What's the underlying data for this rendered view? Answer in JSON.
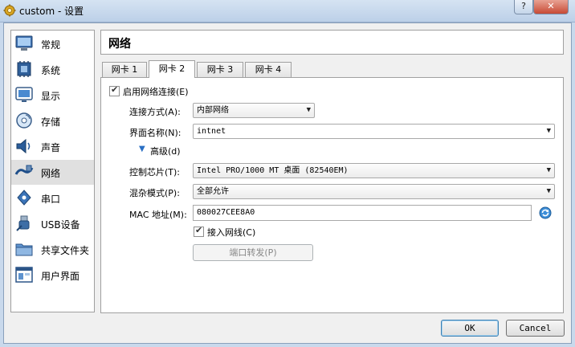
{
  "window": {
    "title": "custom - 设置",
    "help_label": "?",
    "close_label": "✕"
  },
  "sidebar": {
    "items": [
      {
        "label": "常规",
        "icon": "general-icon"
      },
      {
        "label": "系统",
        "icon": "system-icon"
      },
      {
        "label": "显示",
        "icon": "display-icon"
      },
      {
        "label": "存储",
        "icon": "storage-icon"
      },
      {
        "label": "声音",
        "icon": "audio-icon"
      },
      {
        "label": "网络",
        "icon": "network-icon",
        "selected": true
      },
      {
        "label": "串口",
        "icon": "serial-port-icon"
      },
      {
        "label": "USB设备",
        "icon": "usb-icon"
      },
      {
        "label": "共享文件夹",
        "icon": "shared-folder-icon"
      },
      {
        "label": "用户界面",
        "icon": "user-interface-icon"
      }
    ]
  },
  "header": {
    "title": "网络"
  },
  "tabs": [
    {
      "label": "网卡 1"
    },
    {
      "label": "网卡 2",
      "active": true
    },
    {
      "label": "网卡 3"
    },
    {
      "label": "网卡 4"
    }
  ],
  "adapter": {
    "enable_label": "启用网络连接(E)",
    "enable_checked": true,
    "attached_label": "连接方式(A):",
    "attached_value": "内部网络",
    "name_label": "界面名称(N):",
    "name_value": "intnet",
    "advanced_label": "高级(d)",
    "chip_label": "控制芯片(T):",
    "chip_value": "Intel PRO/1000 MT 桌面 (82540EM)",
    "promisc_label": "混杂模式(P):",
    "promisc_value": "全部允许",
    "mac_label": "MAC 地址(M):",
    "mac_value": "080027CEE8A0",
    "cable_label": "接入网线(C)",
    "cable_checked": true,
    "port_forward_label": "端口转发(P)"
  },
  "footer": {
    "ok_label": "OK",
    "cancel_label": "Cancel"
  },
  "colors": {
    "title_bar": "#c9d9ec",
    "selected_item": "#e0e0e0",
    "default_button_border": "#3c7fb1"
  }
}
